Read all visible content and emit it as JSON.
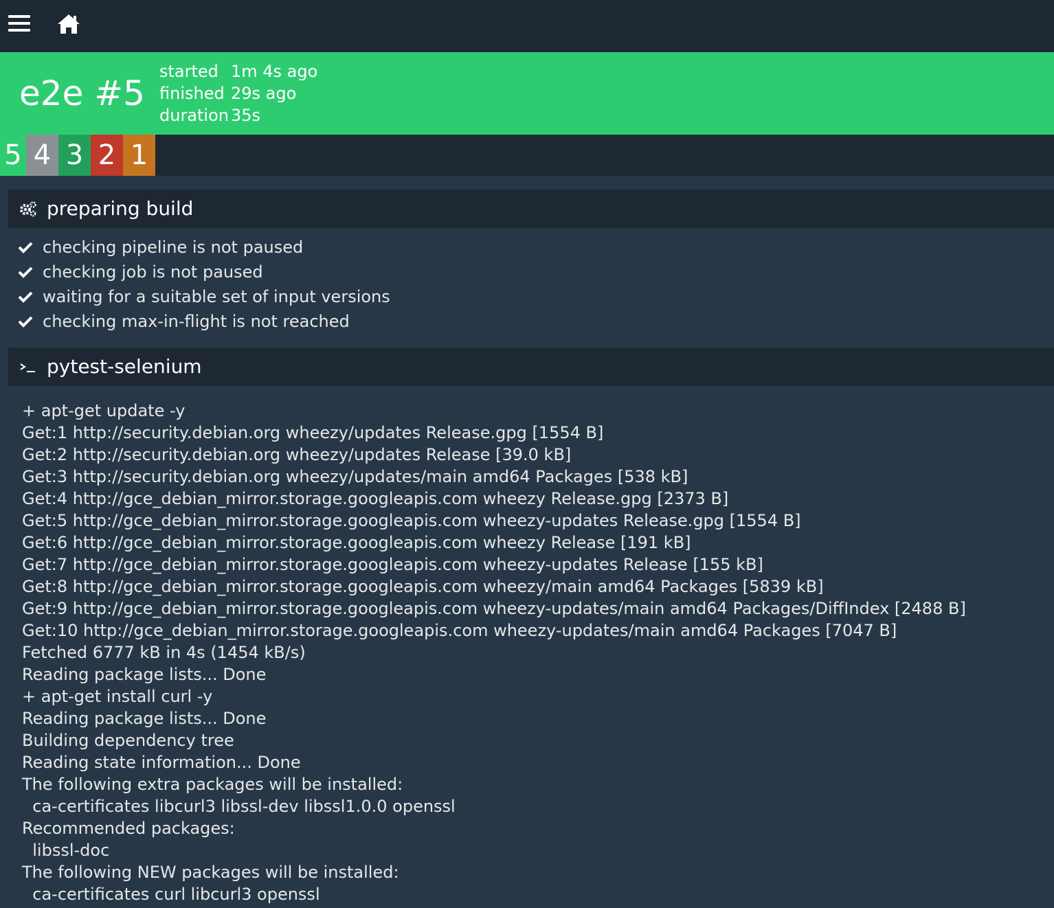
{
  "nav": {
    "menu_icon": "hamburger-menu-icon",
    "home_icon": "home-icon"
  },
  "build": {
    "title": "e2e #5",
    "times": [
      {
        "label": "started",
        "value": "1m 4s ago"
      },
      {
        "label": "finished",
        "value": "29s ago"
      },
      {
        "label": "duration",
        "value": "35s"
      }
    ]
  },
  "tabs": [
    {
      "label": "5",
      "status": "succeeded",
      "color": "#2ecc71"
    },
    {
      "label": "4",
      "status": "aborted",
      "color": "#8b9094"
    },
    {
      "label": "3",
      "status": "succeeded",
      "color": "#22a05a"
    },
    {
      "label": "2",
      "status": "failed",
      "color": "#c0392b"
    },
    {
      "label": "1",
      "status": "errored",
      "color": "#c57420"
    }
  ],
  "preparing": {
    "title": "preparing build",
    "icon": "gears-icon",
    "steps": [
      "checking pipeline is not paused",
      "checking job is not paused",
      "waiting for a suitable set of input versions",
      "checking max-in-flight is not reached"
    ]
  },
  "task": {
    "title": "pytest-selenium",
    "icon": "terminal-icon",
    "log": [
      "+ apt-get update -y",
      "Get:1 http://security.debian.org wheezy/updates Release.gpg [1554 B]",
      "Get:2 http://security.debian.org wheezy/updates Release [39.0 kB]",
      "Get:3 http://security.debian.org wheezy/updates/main amd64 Packages [538 kB]",
      "Get:4 http://gce_debian_mirror.storage.googleapis.com wheezy Release.gpg [2373 B]",
      "Get:5 http://gce_debian_mirror.storage.googleapis.com wheezy-updates Release.gpg [1554 B]",
      "Get:6 http://gce_debian_mirror.storage.googleapis.com wheezy Release [191 kB]",
      "Get:7 http://gce_debian_mirror.storage.googleapis.com wheezy-updates Release [155 kB]",
      "Get:8 http://gce_debian_mirror.storage.googleapis.com wheezy/main amd64 Packages [5839 kB]",
      "Get:9 http://gce_debian_mirror.storage.googleapis.com wheezy-updates/main amd64 Packages/DiffIndex [2488 B]",
      "Get:10 http://gce_debian_mirror.storage.googleapis.com wheezy-updates/main amd64 Packages [7047 B]",
      "Fetched 6777 kB in 4s (1454 kB/s)",
      "Reading package lists... Done",
      "+ apt-get install curl -y",
      "Reading package lists... Done",
      "Building dependency tree",
      "Reading state information... Done",
      "The following extra packages will be installed:",
      "  ca-certificates libcurl3 libssl-dev libssl1.0.0 openssl",
      "Recommended packages:",
      "  libssl-doc",
      "The following NEW packages will be installed:",
      "  ca-certificates curl libcurl3 openssl"
    ]
  }
}
